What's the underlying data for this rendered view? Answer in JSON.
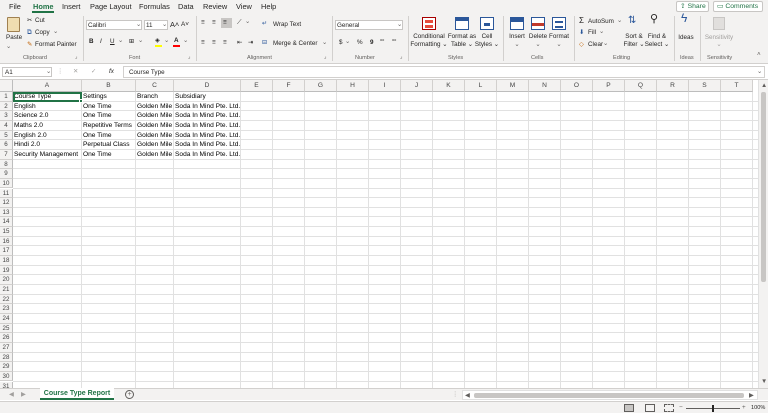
{
  "menu": {
    "file": "File",
    "home": "Home",
    "insert": "Insert",
    "page_layout": "Page Layout",
    "formulas": "Formulas",
    "data": "Data",
    "review": "Review",
    "view": "View",
    "help": "Help",
    "share": "Share",
    "comments": "Comments"
  },
  "ribbon": {
    "paste": "Paste",
    "cut": "Cut",
    "copy": "Copy",
    "format_painter": "Format Painter",
    "font_name": "Calibri",
    "font_size": "11",
    "bold": "B",
    "italic": "I",
    "underline": "U",
    "wrap_text": "Wrap Text",
    "merge_center": "Merge & Center",
    "number_format": "General",
    "currency": "$",
    "percent": "%",
    "comma": "9",
    "conditional_formatting": [
      "Conditional",
      "Formatting"
    ],
    "format_as_table": [
      "Format as",
      "Table"
    ],
    "cell_styles": [
      "Cell",
      "Styles"
    ],
    "insert": "Insert",
    "delete": "Delete",
    "format": "Format",
    "autosum": "AutoSum",
    "fill": "Fill",
    "clear": "Clear",
    "sort_filter": [
      "Sort &",
      "Filter"
    ],
    "find_select": [
      "Find &",
      "Select"
    ],
    "ideas": "Ideas",
    "sensitivity": "Sensitivity",
    "groups": {
      "clipboard": "Clipboard",
      "font": "Font",
      "alignment": "Alignment",
      "number": "Number",
      "styles": "Styles",
      "cells": "Cells",
      "editing": "Editing",
      "ideas": "Ideas",
      "sensitivity": "Sensitivity"
    }
  },
  "formula_bar": {
    "name_box": "A1",
    "fx": "fx",
    "content": "Course Type"
  },
  "columns": [
    "A",
    "B",
    "C",
    "D",
    "E",
    "F",
    "G",
    "H",
    "I",
    "J",
    "K",
    "L",
    "M",
    "N",
    "O",
    "P",
    "Q",
    "R",
    "S",
    "T"
  ],
  "rows": [
    "1",
    "2",
    "3",
    "4",
    "5",
    "6",
    "7",
    "8",
    "9",
    "10",
    "11",
    "12",
    "13",
    "14",
    "15",
    "16",
    "17",
    "18",
    "19",
    "20",
    "21",
    "22",
    "23",
    "24",
    "25",
    "26",
    "27",
    "28",
    "29",
    "30",
    "31"
  ],
  "table": {
    "headers": [
      "Course Type",
      "Settings",
      "Branch",
      "Subsidiary"
    ],
    "rows": [
      [
        "English",
        "One Time",
        "Golden Mile",
        "Soda In Mind Pte. Ltd."
      ],
      [
        "Science 2.0",
        "One Time",
        "Golden Mile",
        "Soda In Mind Pte. Ltd."
      ],
      [
        "Maths 2.0",
        "Repetitive Terms",
        "Golden Mile",
        "Soda In Mind Pte. Ltd."
      ],
      [
        "English 2.0",
        "One Time",
        "Golden Mile",
        "Soda In Mind Pte. Ltd."
      ],
      [
        "Hindi 2.0",
        "Perpetual Class",
        "Golden Mile",
        "Soda In Mind Pte. Ltd."
      ],
      [
        "Security Management",
        "One Time",
        "Golden Mile",
        "Soda In Mind Pte. Ltd."
      ]
    ]
  },
  "sheet_tab": "Course Type Report",
  "status": {
    "zoom": "100%"
  },
  "colors": {
    "accent": "#217346",
    "ribbon_bg": "#f3f2f1",
    "grid_line": "#e1e1e1"
  }
}
